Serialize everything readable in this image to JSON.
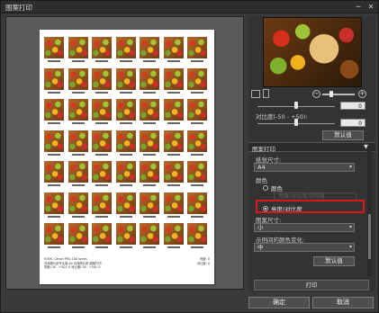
{
  "window": {
    "title": "图案打印",
    "min": "─",
    "close": "✕"
  },
  "preview": {
    "footer_left_1": "EOSK, Canon PRO-100 series",
    "footer_left_2": "光泽照片纸专业版 A4   光泽照片纸   图案打印",
    "footer_left_3": "亮度(-50 - +50): 0   对比度(-50 - +50): 0",
    "footer_right_1": "亮度: 0",
    "footer_right_2": "对比度: 0"
  },
  "panel": {
    "brightness_value": "0",
    "contrast_label": "对比度(-50 - +50):",
    "contrast_value": "0",
    "defaults_label": "默认值",
    "section_title": "图案打印",
    "paper_size_label": "纸张尺寸:",
    "paper_size_value": "A4",
    "color_label": "颜色",
    "color_option": "颜色",
    "color_dim_option": "亮度/对比度/饱和度",
    "brightness_contrast_option": "亮度/对比度",
    "pattern_size_label": "图案尺寸:",
    "pattern_size_value": "小",
    "sample_variation_label": "示例间的颜色变化:",
    "sample_variation_value": "中",
    "defaults_label_2": "默认值",
    "print_label": "打印"
  },
  "buttons": {
    "ok": "确定",
    "cancel": "取消"
  },
  "state": {
    "brightness_position": 0.5,
    "contrast_position": 0.5,
    "zoom_position": 0.3
  }
}
